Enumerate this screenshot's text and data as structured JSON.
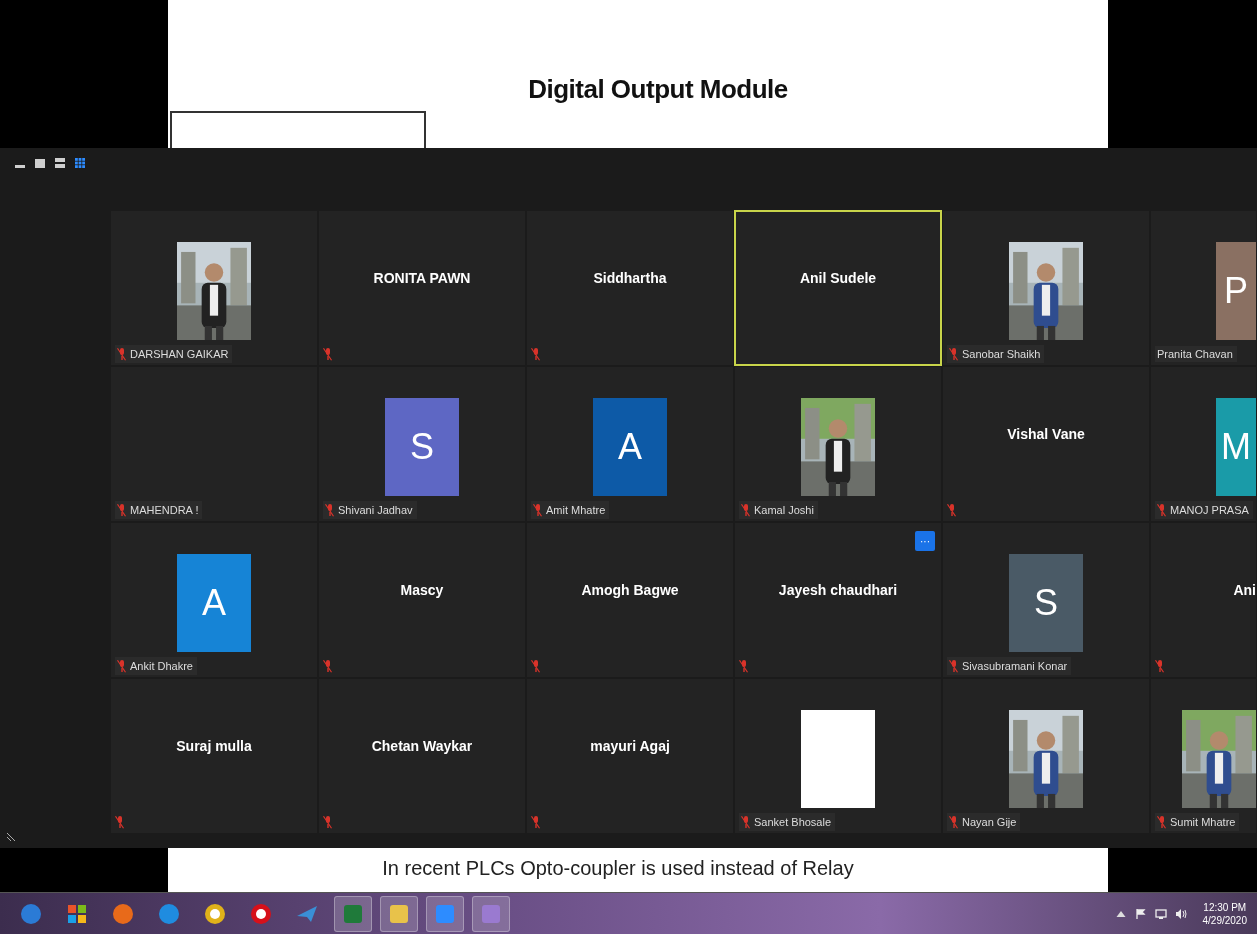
{
  "slide": {
    "title": "Digital Output Module",
    "footer_text": "In recent PLCs Opto-coupler is used instead of Relay"
  },
  "view_buttons": [
    {
      "kind": "minimize",
      "selected": false
    },
    {
      "kind": "single",
      "selected": false
    },
    {
      "kind": "speaker",
      "selected": false
    },
    {
      "kind": "gallery",
      "selected": true
    }
  ],
  "tiles": [
    {
      "name": "DARSHAN GAIKAR",
      "muted": true,
      "speaking": false
    },
    {
      "kind": "name",
      "name": "RONITA PAWN",
      "muted": true,
      "speaking": false
    },
    {
      "kind": "name",
      "name": "Siddhartha",
      "muted": true,
      "speaking": false
    },
    {
      "kind": "name",
      "name": "Anil Sudele",
      "muted": false,
      "speaking": true
    },
    {
      "name": "Sanobar Shaikh",
      "muted": true,
      "speaking": false
    },
    {
      "kind": "avatar",
      "letter": "P",
      "color": "#8a7062",
      "name": "Pranita Chavan",
      "muted": false,
      "speaking": false
    },
    {
      "kind": "blank",
      "name": "MAHENDRA !",
      "muted": true,
      "speaking": false
    },
    {
      "kind": "avatar",
      "letter": "S",
      "color": "#5e67c4",
      "name": "Shivani Jadhav",
      "muted": true,
      "speaking": false
    },
    {
      "kind": "avatar",
      "letter": "A",
      "color": "#0d5aa7",
      "name": "Amit Mhatre",
      "muted": true,
      "speaking": false
    },
    {
      "name": "Kamal Joshi",
      "muted": true,
      "speaking": false
    },
    {
      "kind": "name",
      "name": "Vishal Vane",
      "muted": true,
      "speaking": false
    },
    {
      "kind": "avatar",
      "letter": "M",
      "color": "#1a9ba8",
      "name": "MANOJ PRASA",
      "muted": true,
      "speaking": false
    },
    {
      "kind": "avatar",
      "letter": "A",
      "color": "#1684d6",
      "name": "Ankit Dhakre",
      "muted": true,
      "speaking": false
    },
    {
      "kind": "name",
      "name": "Mascy",
      "muted": true,
      "speaking": false
    },
    {
      "kind": "name",
      "name": "Amogh Bagwe",
      "muted": true,
      "speaking": false
    },
    {
      "kind": "name",
      "name": "Jayesh chaudhari",
      "muted": true,
      "speaking": false,
      "more_button": "···"
    },
    {
      "kind": "avatar",
      "letter": "S",
      "color": "#4a5a66",
      "name": "Sivasubramani Konar",
      "muted": true,
      "speaking": false
    },
    {
      "kind": "name",
      "name": "Ani",
      "muted": true,
      "speaking": false
    },
    {
      "kind": "name",
      "name": "Suraj mulla",
      "muted": true,
      "speaking": false
    },
    {
      "kind": "name",
      "name": "Chetan Waykar",
      "muted": true,
      "speaking": false
    },
    {
      "kind": "name",
      "name": "mayuri Agaj",
      "muted": true,
      "speaking": false
    },
    {
      "kind": "avatar",
      "color": "#ffffff",
      "name": "Sanket Bhosale",
      "muted": true,
      "speaking": false
    },
    {
      "name": "Nayan Gije",
      "muted": true,
      "speaking": false
    },
    {
      "name": "Sumit Mhatre",
      "muted": true,
      "speaking": false
    }
  ],
  "taskbar": {
    "apps": [
      {
        "kind": "start"
      },
      {
        "kind": "windows"
      },
      {
        "kind": "firefox"
      },
      {
        "kind": "ie"
      },
      {
        "kind": "chrome"
      },
      {
        "kind": "opera"
      },
      {
        "kind": "plane"
      },
      {
        "kind": "excel"
      },
      {
        "kind": "folder"
      },
      {
        "kind": "camera"
      },
      {
        "kind": "paint"
      }
    ],
    "time": "12:30 PM",
    "date": "4/29/2020"
  }
}
